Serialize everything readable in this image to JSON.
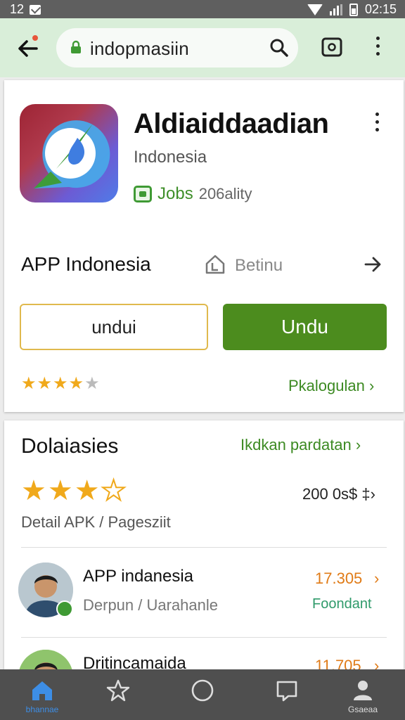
{
  "status_bar": {
    "left_text": "12",
    "time": "02:15"
  },
  "browser": {
    "url": "indopmasiin"
  },
  "app_card": {
    "title": "Aldiaiddaadian",
    "subtitle": "Indonesia",
    "badge_green": "Jobs",
    "badge_grey": "206ality",
    "info_title": "APP Indonesia",
    "info_label": "Betinu",
    "button_outline": "undui",
    "button_solid": "Undu",
    "link": "Pkalogulan ›"
  },
  "review_card": {
    "title": "Dolaiasies",
    "link": "Ikdkan pardatan ›",
    "count": "200 0s$ ‡›",
    "detail": "Detail APK / Pagesziit",
    "reviewers": [
      {
        "name": "APP indanesia",
        "sub": "Derpun / Uarahanle",
        "num": "17.305",
        "tag": "Foondant"
      },
      {
        "name": "Dritincamaida",
        "num": "11.705"
      }
    ]
  },
  "bottom_nav": {
    "home_label": "bhannae",
    "profile_label": "Gsaeaa"
  },
  "colors": {
    "accent_green": "#4c8c1e",
    "star": "#f0a91b",
    "browser_bar": "#d9eed9",
    "nav_bg": "#4f4f4f"
  },
  "icons": [
    "back-arrow-icon",
    "lock-icon",
    "search-icon",
    "tabs-icon",
    "more-icon",
    "house-icon",
    "arrow-right-icon",
    "star-icon",
    "home-icon",
    "circle-icon",
    "bookmark-icon",
    "profile-icon"
  ]
}
